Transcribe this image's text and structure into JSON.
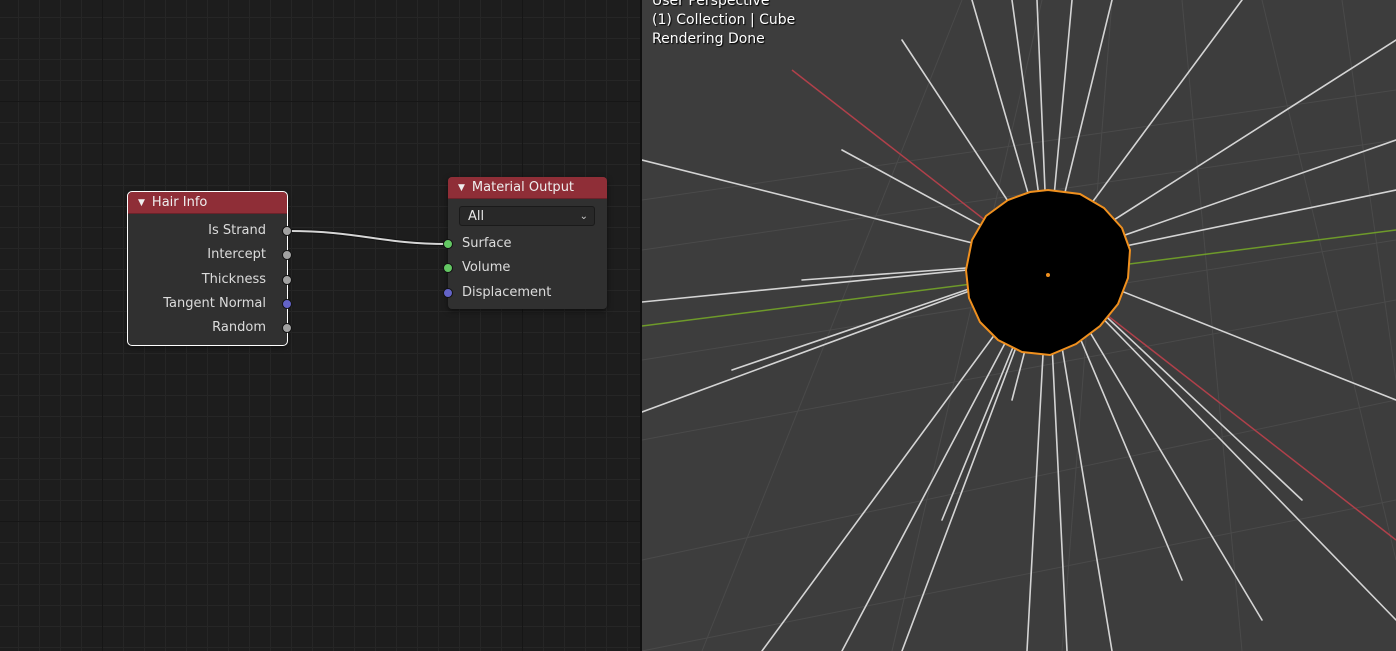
{
  "node_editor": {
    "hair_info_node": {
      "title": "Hair Info",
      "outputs": [
        {
          "label": "Is Strand",
          "socket": "gray"
        },
        {
          "label": "Intercept",
          "socket": "gray"
        },
        {
          "label": "Thickness",
          "socket": "gray"
        },
        {
          "label": "Tangent Normal",
          "socket": "blue"
        },
        {
          "label": "Random",
          "socket": "gray"
        }
      ]
    },
    "material_output_node": {
      "title": "Material Output",
      "target": "All",
      "inputs": [
        {
          "label": "Surface",
          "socket": "green"
        },
        {
          "label": "Volume",
          "socket": "green"
        },
        {
          "label": "Displacement",
          "socket": "blue"
        }
      ]
    }
  },
  "viewport": {
    "view_name": "User Perspective",
    "collection_info": "(1) Collection | Cube",
    "status": "Rendering Done"
  },
  "colors": {
    "node_header": "#8f2e37",
    "selection_outline": "#f0901e",
    "x_axis": "#b0404a",
    "y_axis": "#6e9a2a",
    "socket_gray": "#a1a1a1",
    "socket_blue": "#6363c7",
    "socket_green": "#63c763"
  }
}
